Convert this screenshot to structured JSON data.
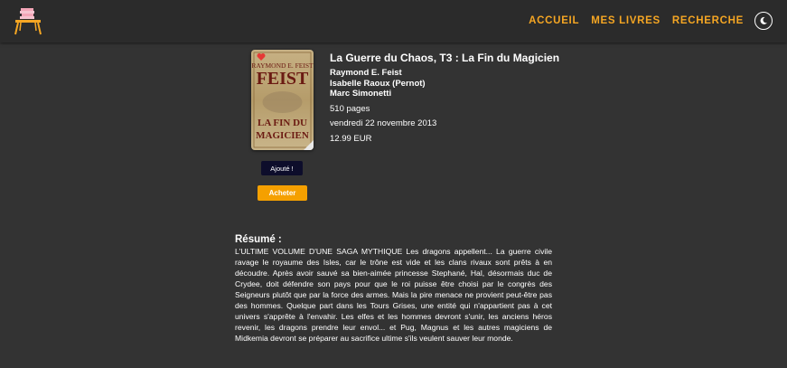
{
  "nav": {
    "links": [
      "ACCUEIL",
      "MES LIVRES",
      "RECHERCHE"
    ],
    "theme_icon": "moon-icon",
    "logo_icon": "stacked-books-on-table-icon"
  },
  "colors": {
    "accent": "#f5a623",
    "background": "#333333",
    "navbar": "#2b2b2b",
    "badge": "#0d0d2b",
    "heart": "#e53935"
  },
  "book": {
    "cover": {
      "author_text": "RAYMOND E. FEIST",
      "title_text": "LA FIN DU MAGICIEN"
    },
    "title": "La Guerre du Chaos, T3 : La Fin du Magicien",
    "authors": [
      "Raymond E. Feist",
      "Isabelle Raoux (Pernot)",
      "Marc Simonetti"
    ],
    "pages": "510 pages",
    "date": "vendredi 22 novembre 2013",
    "price": "12.99 EUR",
    "added_label": "Ajouté !",
    "buy_label": "Acheter",
    "favorite_icon": "heart-icon"
  },
  "summary": {
    "label": "Résumé :",
    "text": "L'ULTIME VOLUME D'UNE SAGA MYTHIQUE Les dragons appellent... La guerre civile ravage le royaume des Isles, car le trône est vide et les clans rivaux sont prêts à en découdre. Après avoir sauvé sa bien-aimée princesse Stephané, Hal, désormais duc de Crydee, doit défendre son pays pour que le roi puisse être choisi par le congrès des Seigneurs plutôt que par la force des armes. Mais la pire menace ne provient peut-être pas des hommes. Quelque part dans les Tours Grises, une entité qui n'appartient pas à cet univers s'apprête à l'envahir. Les elfes et les hommes devront s'unir, les anciens héros revenir, les dragons prendre leur envol... et Pug, Magnus et les autres magiciens de Midkemia devront se préparer au sacrifice ultime s'ils veulent sauver leur monde."
  }
}
